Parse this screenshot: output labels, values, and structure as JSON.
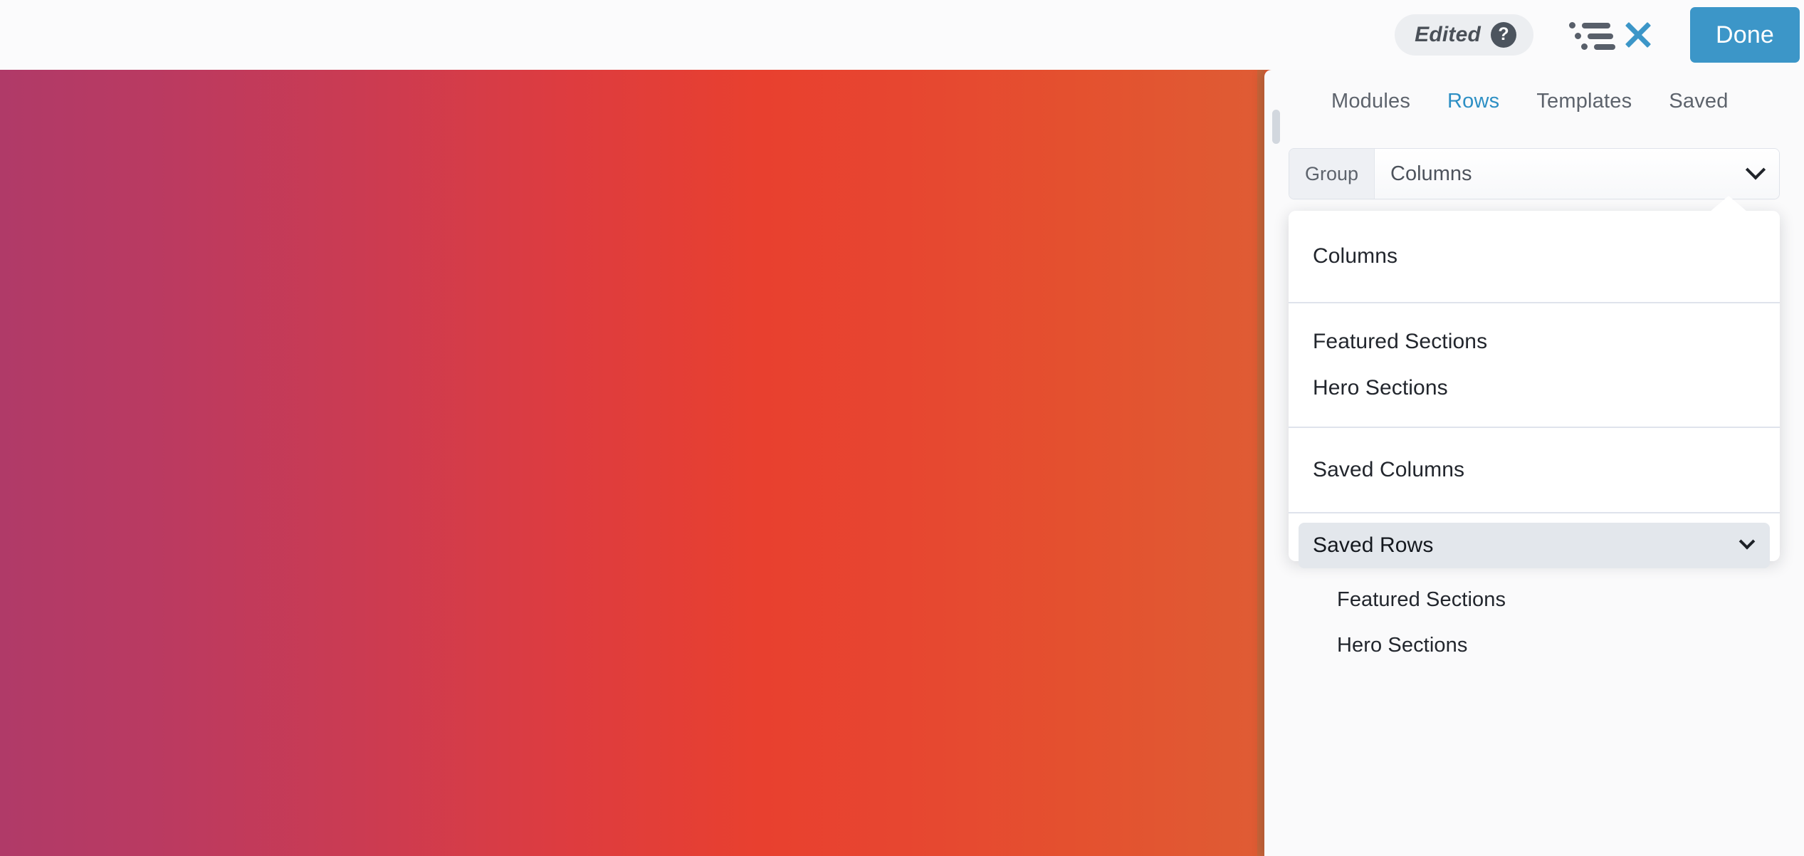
{
  "topbar": {
    "edited_label": "Edited",
    "help_icon": "question-mark-circle-icon",
    "help_glyph": "?",
    "outline_icon": "outline-list-icon",
    "close_icon": "close-x-icon",
    "done_label": "Done",
    "accent_blue": "#3c96c8",
    "badge_bg": "#eceef1"
  },
  "canvas": {
    "gradient_from": "#b03a68",
    "gradient_mid": "#e8402f",
    "gradient_to": "#cf713d",
    "edge_stripe": "#c8653a"
  },
  "panel": {
    "tabs": [
      {
        "label": "Modules",
        "active": false
      },
      {
        "label": "Rows",
        "active": true
      },
      {
        "label": "Templates",
        "active": false
      },
      {
        "label": "Saved",
        "active": false
      }
    ],
    "group_select": {
      "label": "Group",
      "value": "Columns",
      "caret_icon": "chevron-down-icon"
    },
    "dropdown": {
      "groups": [
        {
          "items": [
            {
              "label": "Columns",
              "type": "item"
            }
          ]
        },
        {
          "items": [
            {
              "label": "Featured Sections",
              "type": "item"
            },
            {
              "label": "Hero Sections",
              "type": "item"
            }
          ]
        },
        {
          "items": [
            {
              "label": "Saved Columns",
              "type": "item"
            }
          ]
        },
        {
          "items": [
            {
              "label": "Saved Rows",
              "type": "expandable",
              "expanded": true,
              "caret_icon": "chevron-down-icon"
            },
            {
              "label": "Featured Sections",
              "type": "child"
            },
            {
              "label": "Hero Sections",
              "type": "child"
            }
          ]
        }
      ]
    }
  }
}
